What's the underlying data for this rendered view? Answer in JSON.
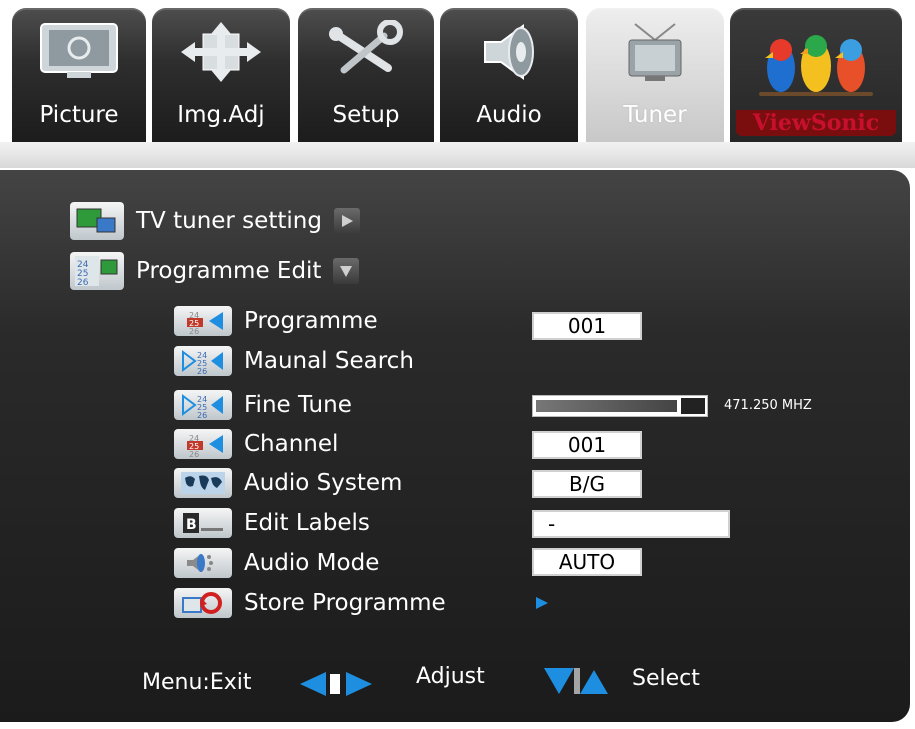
{
  "tabs": [
    {
      "label": "Picture",
      "icon": "monitor-icon"
    },
    {
      "label": "Img.Adj",
      "icon": "move-arrows-icon"
    },
    {
      "label": "Setup",
      "icon": "wrench-screwdriver-icon"
    },
    {
      "label": "Audio",
      "icon": "speaker-icon"
    },
    {
      "label": "Tuner",
      "icon": "tv-antenna-icon",
      "active": true
    },
    {
      "label": "ViewSonic",
      "icon": "birds-logo-icon"
    }
  ],
  "menu": {
    "tv_tuner_setting": "TV tuner setting",
    "programme_edit": "Programme Edit",
    "items": [
      {
        "label": "Programme",
        "value": "001"
      },
      {
        "label": "Maunal Search"
      },
      {
        "label": "Fine Tune",
        "progress": 0.83,
        "readout": "471.250 MHZ"
      },
      {
        "label": "Channel",
        "value": "001"
      },
      {
        "label": "Audio System",
        "value": "B/G"
      },
      {
        "label": "Edit Labels",
        "value": "-"
      },
      {
        "label": "Audio Mode",
        "value": "AUTO"
      },
      {
        "label": "Store Programme"
      }
    ]
  },
  "footer": {
    "menu_exit": "Menu:Exit",
    "adjust": "Adjust",
    "select": "Select"
  },
  "colors": {
    "accent_blue": "#1e8fe0",
    "brand_red": "#c8102e"
  }
}
